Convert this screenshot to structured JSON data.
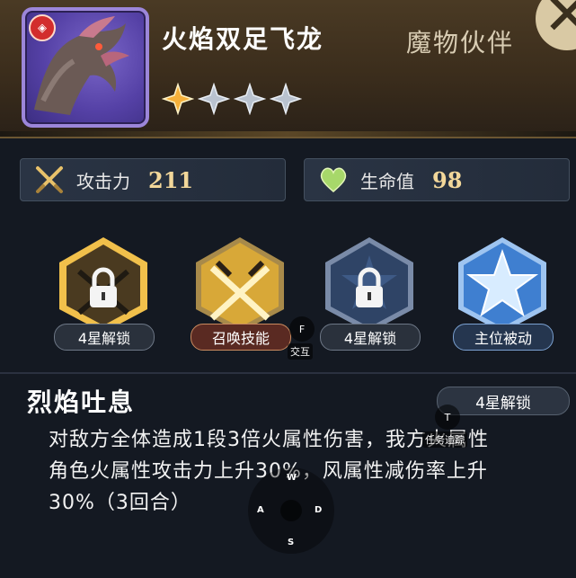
{
  "header": {
    "name": "火焰双足飞龙",
    "category": "魔物伙伴",
    "close_glyph": "✕",
    "element_glyph": "◈",
    "stars_filled": 1,
    "stars_total": 4
  },
  "stats": {
    "attack": {
      "label": "攻击力",
      "value": "211",
      "icon": "crossed-swords-icon"
    },
    "health": {
      "label": "生命值",
      "value": "98",
      "icon": "heart-icon"
    }
  },
  "skills": [
    {
      "label": "4星解锁",
      "state": "locked-selected"
    },
    {
      "label": "召唤技能",
      "state": "active"
    },
    {
      "label": "4星解锁",
      "state": "locked"
    },
    {
      "label": "主位被动",
      "state": "passive"
    }
  ],
  "detail": {
    "title": "烈焰吐息",
    "unlock": "4星解锁",
    "line1": "对敌方全体造成1段3倍火属性伤害，我方火属性",
    "line2": "角色火属性攻击力上升30%，风属性减伤率上升",
    "line3": "30%（3回合）"
  },
  "overlay": {
    "interact_key": "F",
    "interact_label": "交互",
    "task_key": "T",
    "task_label": "任务追踪",
    "joystick": {
      "up": "W",
      "left": "A",
      "down": "S",
      "right": "D"
    }
  },
  "colors": {
    "accent_gold": "#f2d79a",
    "fire_red": "#d22d2d"
  }
}
